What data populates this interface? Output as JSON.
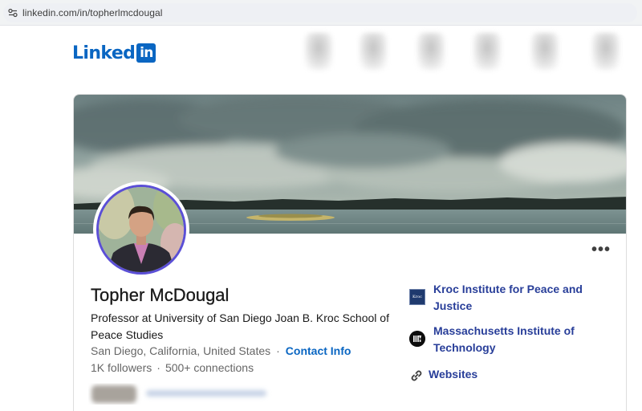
{
  "browser": {
    "url": "linkedin.com/in/topherlmcdougal"
  },
  "nav": {
    "logo_text": "Linked",
    "logo_box_text": "in",
    "brand_color": "#0a66c2"
  },
  "profile": {
    "name": "Topher McDougal",
    "headline": "Professor at University of San Diego Joan B. Kroc School of Peace Studies",
    "location": "San Diego, California, United States",
    "separator": "·",
    "contact_info_label": "Contact Info",
    "followers": "1K followers",
    "connections": "500+ connections",
    "more_actions_label": "•••",
    "avatar_ring_color": "#5b4fd6"
  },
  "sidebar_orgs": [
    {
      "label": "Kroc Institute for Peace and Justice",
      "logo_text": "Kroc",
      "icon": "kroc-logo-icon"
    },
    {
      "label": "Massachusetts Institute of Technology",
      "logo_text": "MIT",
      "icon": "mit-logo-icon"
    }
  ],
  "websites_label": "Websites",
  "link_color": "#283e99"
}
